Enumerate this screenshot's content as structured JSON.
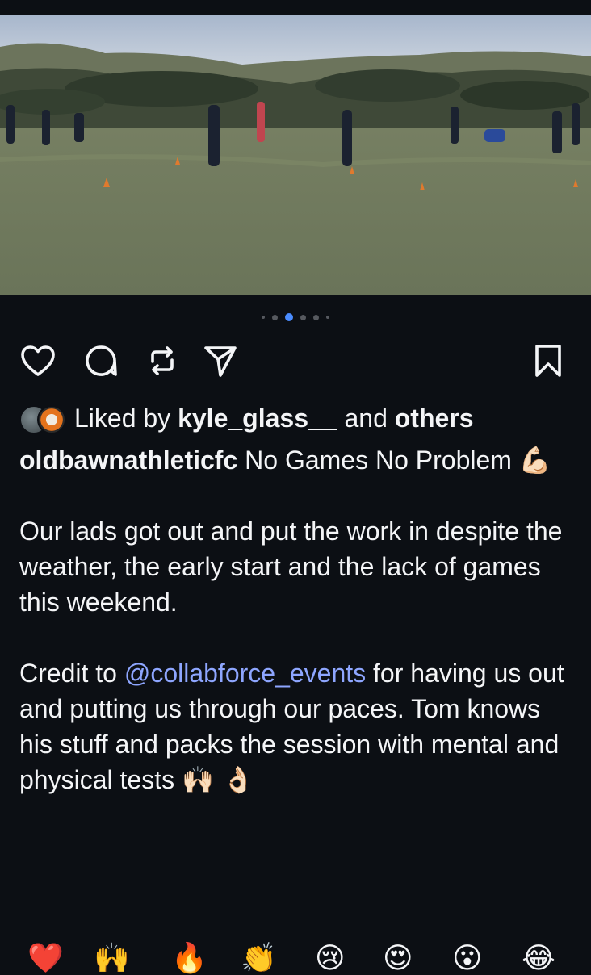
{
  "carousel": {
    "total": 5,
    "active": 2
  },
  "actions": {
    "like": "heart-icon",
    "comment": "comment-icon",
    "repost": "repost-icon",
    "share": "share-icon",
    "save": "bookmark-icon"
  },
  "likes": {
    "prefix": "Liked by ",
    "user": "kyle_glass__",
    "middle": " and ",
    "others": "others"
  },
  "caption": {
    "username": "oldbawnathleticfc",
    "title": " No Games No Problem ",
    "title_emoji": "💪🏻",
    "paragraph2": "Our lads got out and put the work in despite the weather, the early start and the lack of games this weekend.",
    "credit_prefix": "Credit to ",
    "mention": "@collabforce_events",
    "credit_rest": " for having us out and putting us through our paces. Tom knows his stuff and packs the session with mental and physical tests ",
    "end_emoji": "🙌🏻 👌🏻"
  },
  "reactions": [
    "❤️",
    "🙌",
    "🔥",
    "👏",
    "😢",
    "😍",
    "😮",
    "😂"
  ],
  "colors": {
    "background": "#0c0f14",
    "accent": "#4a8cff",
    "mention": "#8ea6ff"
  }
}
